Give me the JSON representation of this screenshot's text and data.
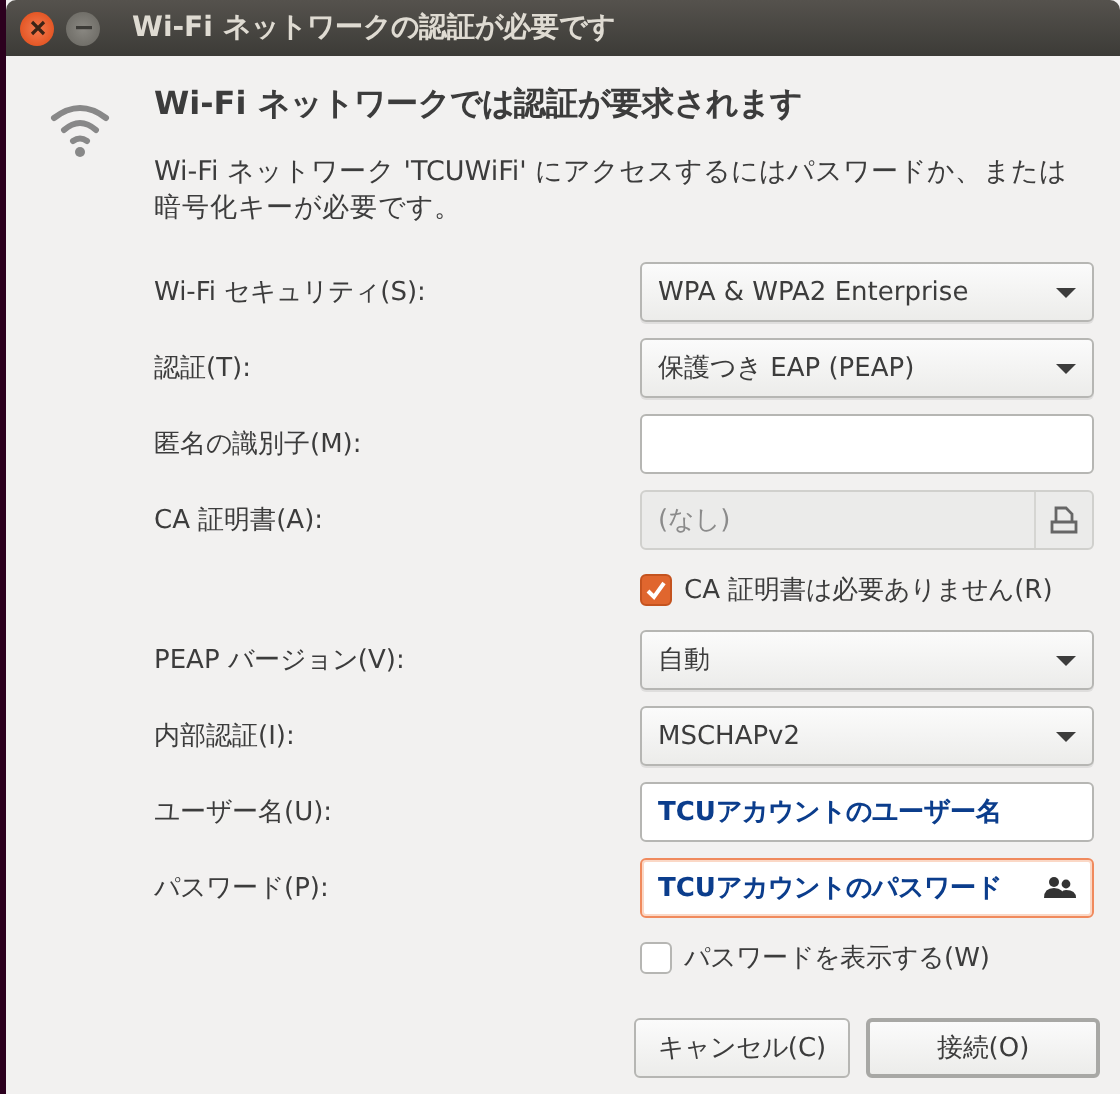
{
  "window": {
    "title": "Wi-Fi ネットワークの認証が必要です"
  },
  "heading": "Wi-Fi ネットワークでは認証が要求されます",
  "description": "Wi-Fi ネットワーク 'TCUWiFi' にアクセスするにはパスワードか、または暗号化キーが必要です。",
  "fields": [
    {
      "kind": "combo",
      "label": "Wi-Fi セキュリティ(S):",
      "value": "WPA & WPA2 Enterprise"
    },
    {
      "kind": "combo",
      "label": "認証(T):",
      "value": "保護つき EAP (PEAP)"
    },
    {
      "kind": "entry",
      "label": "匿名の識別子(M):",
      "focused": false
    },
    {
      "kind": "file",
      "label": "CA 証明書(A):",
      "value": "(なし)",
      "disabled": true
    },
    {
      "kind": "checkbox",
      "label": "CA 証明書は必要ありません(R)",
      "checked": true
    },
    {
      "kind": "combo",
      "label": "PEAP バージョン(V):",
      "value": "自動"
    },
    {
      "kind": "combo",
      "label": "内部認証(I):",
      "value": "MSCHAPv2"
    },
    {
      "kind": "entry",
      "label": "ユーザー名(U):",
      "value": "TCUアカウントのユーザー名",
      "focused": false
    },
    {
      "kind": "password",
      "label": "パスワード(P):",
      "value": "TCUアカウントのパスワード",
      "focused": true
    },
    {
      "kind": "checkbox",
      "label": "パスワードを表示する(W)",
      "checked": false
    }
  ],
  "buttons": [
    {
      "label": "キャンセル(C)",
      "default": false
    },
    {
      "label": "接続(O)",
      "default": true
    }
  ]
}
